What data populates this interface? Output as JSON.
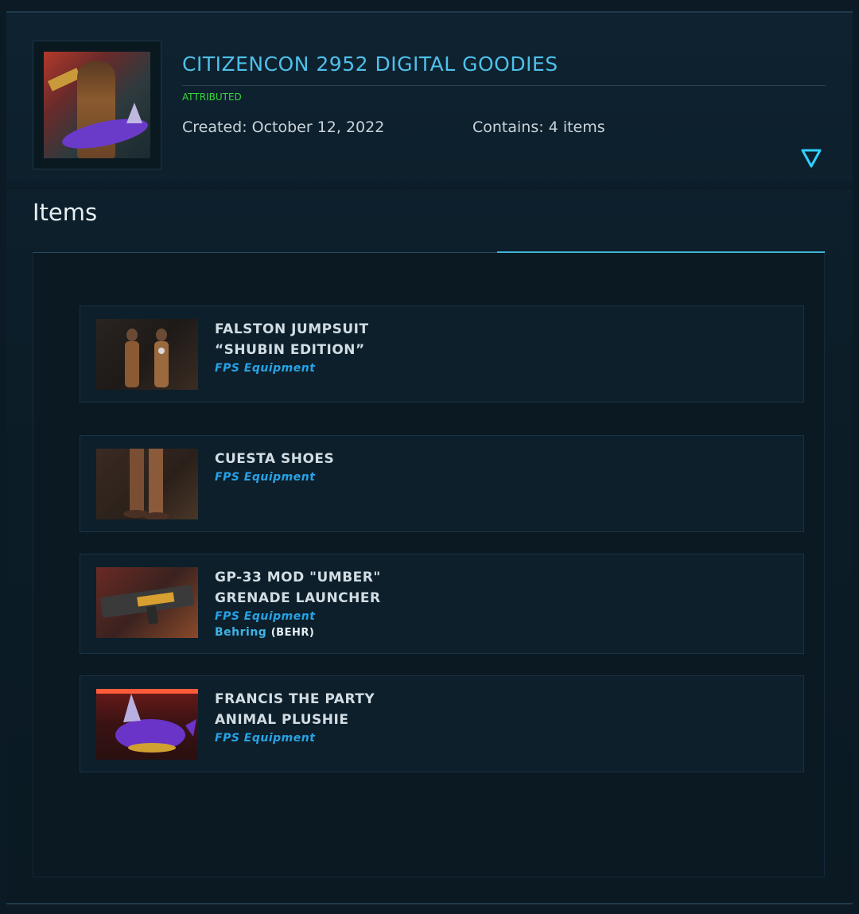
{
  "pledge": {
    "title": "CITIZENCON 2952 DIGITAL GOODIES",
    "status": "ATTRIBUTED",
    "created": "Created: October 12, 2022",
    "contains": "Contains: 4 items",
    "status_color": "#35d935",
    "accent_color": "#4fc0ea"
  },
  "toggle_icon": "triangle-down-icon",
  "section": {
    "heading": "Items"
  },
  "items": [
    {
      "name_line1": "FALSTON JUMPSUIT",
      "name_line2": "“SHUBIN EDITION”",
      "category": "FPS Equipment",
      "manufacturer": "",
      "manufacturer_code": ""
    },
    {
      "name_line1": "CUESTA SHOES",
      "name_line2": "",
      "category": "FPS Equipment",
      "manufacturer": "",
      "manufacturer_code": ""
    },
    {
      "name_line1": "GP-33 MOD \"UMBER\"",
      "name_line2": "GRENADE LAUNCHER",
      "category": "FPS Equipment",
      "manufacturer": "Behring",
      "manufacturer_open": "(",
      "manufacturer_code": "BEHR",
      "manufacturer_close": ")"
    },
    {
      "name_line1": "FRANCIS THE PARTY",
      "name_line2": "ANIMAL PLUSHIE",
      "category": "FPS Equipment",
      "manufacturer": "",
      "manufacturer_code": ""
    }
  ]
}
